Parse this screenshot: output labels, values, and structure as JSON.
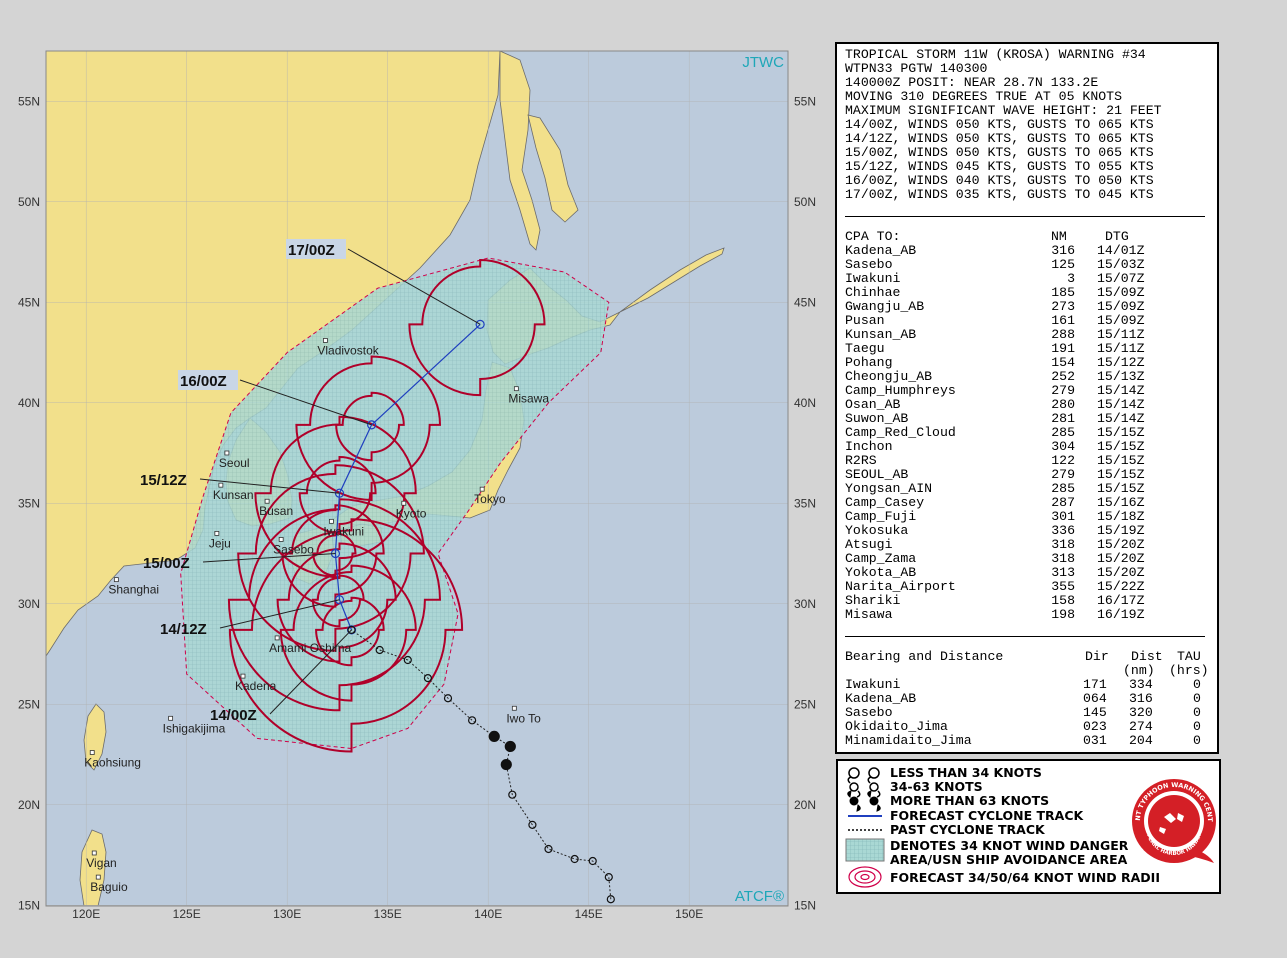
{
  "map": {
    "corner_top": "JTWC",
    "corner_bottom": "ATCF®",
    "lat_labels": [
      "55N",
      "50N",
      "45N",
      "40N",
      "35N",
      "30N",
      "25N",
      "20N",
      "15N"
    ],
    "lon_labels": [
      "120E",
      "125E",
      "130E",
      "135E",
      "140E",
      "145E",
      "150E"
    ],
    "places": [
      {
        "name": "Vladivostok",
        "lon": 131.9,
        "lat": 43.1
      },
      {
        "name": "Misawa",
        "lon": 141.4,
        "lat": 40.7
      },
      {
        "name": "Seoul",
        "lon": 127.0,
        "lat": 37.5
      },
      {
        "name": "Kunsan",
        "lon": 126.7,
        "lat": 35.9
      },
      {
        "name": "Busan",
        "lon": 129.0,
        "lat": 35.1
      },
      {
        "name": "Kyoto",
        "lon": 135.8,
        "lat": 35.0
      },
      {
        "name": "Tokyo",
        "lon": 139.7,
        "lat": 35.7
      },
      {
        "name": "Jeju",
        "lon": 126.5,
        "lat": 33.5
      },
      {
        "name": "Iwakuni",
        "lon": 132.2,
        "lat": 34.1
      },
      {
        "name": "Sasebo",
        "lon": 129.7,
        "lat": 33.2
      },
      {
        "name": "Shanghai",
        "lon": 121.5,
        "lat": 31.2
      },
      {
        "name": "Amami Oshima",
        "lon": 129.5,
        "lat": 28.3
      },
      {
        "name": "Kadena",
        "lon": 127.8,
        "lat": 26.4
      },
      {
        "name": "Iwo To",
        "lon": 141.3,
        "lat": 24.8
      },
      {
        "name": "Ishigakijima",
        "lon": 124.2,
        "lat": 24.3
      },
      {
        "name": "Kaohsiung",
        "lon": 120.3,
        "lat": 22.6
      },
      {
        "name": "Vigan",
        "lon": 120.4,
        "lat": 17.6
      },
      {
        "name": "Baguio",
        "lon": 120.6,
        "lat": 16.4
      }
    ],
    "time_labels": [
      "17/00Z",
      "16/00Z",
      "15/12Z",
      "15/00Z",
      "14/12Z",
      "14/00Z"
    ],
    "forecast_track": [
      {
        "tau": "14/00Z",
        "lon": 133.2,
        "lat": 28.7
      },
      {
        "tau": "14/12Z",
        "lon": 132.6,
        "lat": 30.2
      },
      {
        "tau": "15/00Z",
        "lon": 132.4,
        "lat": 32.5
      },
      {
        "tau": "15/12Z",
        "lon": 132.6,
        "lat": 35.5
      },
      {
        "tau": "16/00Z",
        "lon": 134.2,
        "lat": 38.9
      },
      {
        "tau": "17/00Z",
        "lon": 139.6,
        "lat": 43.9
      }
    ],
    "past_track": [
      {
        "lon": 146.1,
        "lat": 15.3
      },
      {
        "lon": 146.0,
        "lat": 16.4
      },
      {
        "lon": 145.2,
        "lat": 17.2
      },
      {
        "lon": 144.3,
        "lat": 17.3
      },
      {
        "lon": 143.0,
        "lat": 17.8
      },
      {
        "lon": 142.2,
        "lat": 19.0
      },
      {
        "lon": 141.2,
        "lat": 20.5
      },
      {
        "lon": 140.9,
        "lat": 22.0
      },
      {
        "lon": 141.1,
        "lat": 22.9
      },
      {
        "lon": 140.3,
        "lat": 23.4
      },
      {
        "lon": 139.2,
        "lat": 24.2
      },
      {
        "lon": 138.0,
        "lat": 25.3
      },
      {
        "lon": 137.0,
        "lat": 26.3
      },
      {
        "lon": 136.0,
        "lat": 27.2
      },
      {
        "lon": 134.6,
        "lat": 27.7
      },
      {
        "lon": 133.2,
        "lat": 28.7
      }
    ],
    "colors": {
      "land": "#f2e08b",
      "sea": "#bccbdc",
      "danger": "#9fd4d4",
      "radii": "#b0002a",
      "track": "#1f3fbf"
    }
  },
  "info": {
    "header": [
      "TROPICAL STORM 11W (KROSA) WARNING #34",
      "WTPN33 PGTW 140300",
      "140000Z POSIT: NEAR 28.7N 133.2E",
      "MOVING 310 DEGREES TRUE AT 05 KNOTS",
      "MAXIMUM SIGNIFICANT WAVE HEIGHT: 21 FEET",
      "14/00Z, WINDS 050 KTS, GUSTS TO 065 KTS",
      "14/12Z, WINDS 050 KTS, GUSTS TO 065 KTS",
      "15/00Z, WINDS 050 KTS, GUSTS TO 065 KTS",
      "15/12Z, WINDS 045 KTS, GUSTS TO 055 KTS",
      "16/00Z, WINDS 040 KTS, GUSTS TO 050 KTS",
      "17/00Z, WINDS 035 KTS, GUSTS TO 045 KTS"
    ],
    "cpa_title": "CPA TO:",
    "cpa_col_nm": "NM",
    "cpa_col_dtg": "DTG",
    "cpa": [
      [
        "Kadena_AB",
        "316",
        "14/01Z"
      ],
      [
        "Sasebo",
        "125",
        "15/03Z"
      ],
      [
        "Iwakuni",
        "3",
        "15/07Z"
      ],
      [
        "Chinhae",
        "185",
        "15/09Z"
      ],
      [
        "Gwangju_AB",
        "273",
        "15/09Z"
      ],
      [
        "Pusan",
        "161",
        "15/09Z"
      ],
      [
        "Kunsan_AB",
        "288",
        "15/11Z"
      ],
      [
        "Taegu",
        "191",
        "15/11Z"
      ],
      [
        "Pohang",
        "154",
        "15/12Z"
      ],
      [
        "Cheongju_AB",
        "252",
        "15/13Z"
      ],
      [
        "Camp_Humphreys",
        "279",
        "15/14Z"
      ],
      [
        "Osan_AB",
        "280",
        "15/14Z"
      ],
      [
        "Suwon_AB",
        "281",
        "15/14Z"
      ],
      [
        "Camp_Red_Cloud",
        "285",
        "15/15Z"
      ],
      [
        "Inchon",
        "304",
        "15/15Z"
      ],
      [
        "R2RS",
        "122",
        "15/15Z"
      ],
      [
        "SEOUL_AB",
        "279",
        "15/15Z"
      ],
      [
        "Yongsan_AIN",
        "285",
        "15/15Z"
      ],
      [
        "Camp_Casey",
        "287",
        "15/16Z"
      ],
      [
        "Camp_Fuji",
        "301",
        "15/18Z"
      ],
      [
        "Yokosuka",
        "336",
        "15/19Z"
      ],
      [
        "Atsugi",
        "318",
        "15/20Z"
      ],
      [
        "Camp_Zama",
        "318",
        "15/20Z"
      ],
      [
        "Yokota_AB",
        "313",
        "15/20Z"
      ],
      [
        "Narita_Airport",
        "355",
        "15/22Z"
      ],
      [
        "Shariki",
        "158",
        "16/17Z"
      ],
      [
        "Misawa",
        "198",
        "16/19Z"
      ]
    ],
    "bd_title": "Bearing and Distance",
    "bd_col_dir": "Dir",
    "bd_col_dist": "Dist",
    "bd_col_tau": "TAU",
    "bd_col_dist_unit": "(nm)",
    "bd_col_tau_unit": "(hrs)",
    "bd": [
      [
        "Iwakuni",
        "171",
        "334",
        "0"
      ],
      [
        "Kadena_AB",
        "064",
        "316",
        "0"
      ],
      [
        "Sasebo",
        "145",
        "320",
        "0"
      ],
      [
        "Okidaito_Jima",
        "023",
        "274",
        "0"
      ],
      [
        "Minamidaito_Jima",
        "031",
        "204",
        "0"
      ]
    ]
  },
  "legend": {
    "items": [
      "LESS THAN 34 KNOTS",
      "34-63 KNOTS",
      "MORE THAN 63 KNOTS",
      "FORECAST CYCLONE TRACK",
      "PAST CYCLONE TRACK",
      "DENOTES 34 KNOT WIND DANGER",
      "AREA/USN SHIP AVOIDANCE AREA",
      "FORECAST 34/50/64 KNOT WIND RADII"
    ],
    "seal_top": "JOINT TYPHOON WARNING CENTER",
    "seal_bottom": "PEARL HARBOR HAWAII"
  }
}
